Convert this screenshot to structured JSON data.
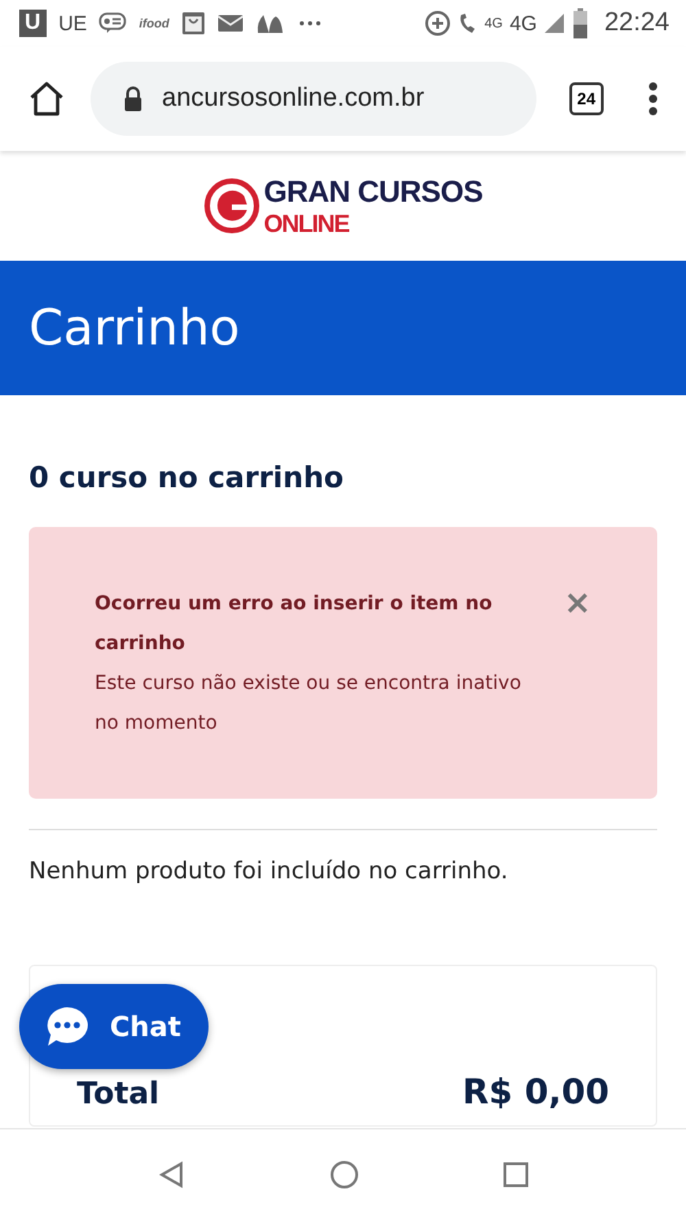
{
  "status_bar": {
    "app_letter": "U",
    "carrier": "UE",
    "ifood": "ifood",
    "call_net": "4G",
    "net": "4G",
    "time": "22:24"
  },
  "browser": {
    "url": "ancursosonline.com.br",
    "tab_count": "24"
  },
  "logo": {
    "line1": "GRAN CURSOS",
    "line2": "ONLINE"
  },
  "page_title": "Carrinho",
  "cart_count": "0 curso no carrinho",
  "alert": {
    "title": "Ocorreu um erro ao inserir o item no carrinho",
    "message": "Este curso não existe ou se encontra inativo no momento",
    "close": "×"
  },
  "empty_message": "Nenhum produto foi incluído no carrinho.",
  "summary": {
    "label": "Total",
    "value": "R$ 0,00"
  },
  "chat_button": {
    "label": "Chat"
  }
}
